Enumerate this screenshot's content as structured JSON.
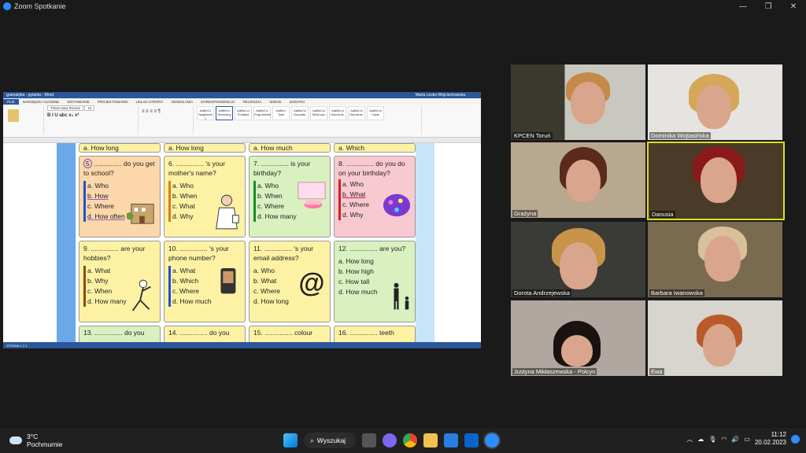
{
  "window": {
    "title": "Zoom Spotkanie"
  },
  "word": {
    "title_bar": "gramatyka - pytania - Word",
    "user": "Maria Lesko-Wojciechowska",
    "tabs": [
      "PLIK",
      "NARZĘDZIA GŁÓWNE",
      "WSTAWIANIE",
      "PROJEKTOWANIE",
      "UKŁAD STRONY",
      "ODWOŁANIA",
      "KORESPONDENCJA",
      "RECENZJA",
      "WIDOK",
      "DODATKI"
    ],
    "font": "Times New Roman",
    "font_size": "12",
    "styles": [
      "AaBbCc",
      "AaBbCc",
      "AaBbCcI",
      "AaBbCcI",
      "AaBbC",
      "AaBbCcI",
      "AaBbCcI",
      "AaBbCcI",
      "AaBbCcI",
      "AaBbCcI"
    ],
    "style_names": [
      "Nagłówek 1",
      "Normalny",
      "Podtytuł",
      "Pogrubienie",
      "Tytuł",
      "Uwydatn.",
      "Tekst wyr.",
      "Wyróżnie.",
      "Wyróżnie.",
      "Cytat"
    ],
    "status": "STRONA 1 Z 1"
  },
  "worksheet": {
    "top": [
      "a. How long",
      "a. How long",
      "a. How much",
      "a. Which"
    ],
    "cells": [
      {
        "num": "5",
        "q": "............... do you get to school?",
        "opts": [
          "a. Who",
          "b. How",
          "c. Where",
          "d. How often"
        ]
      },
      {
        "num": "6.",
        "q": "............... 's your mother's name?",
        "opts": [
          "a. Who",
          "b. When",
          "c. What",
          "d. Why"
        ]
      },
      {
        "num": "7.",
        "q": "............... is your birthday?",
        "opts": [
          "a. Who",
          "b. When",
          "c. Where",
          "d. How many"
        ]
      },
      {
        "num": "8.",
        "q": "............... do you do on your birthday?",
        "opts": [
          "a. Who",
          "b. What",
          "c. Where",
          "d. Why"
        ]
      },
      {
        "num": "9.",
        "q": "............... are your hobbies?",
        "opts": [
          "a. What",
          "b. Why",
          "c. When",
          "d. How many"
        ]
      },
      {
        "num": "10.",
        "q": "............... 's your phone number?",
        "opts": [
          "a. What",
          "b. Which",
          "c. Where",
          "d. How much"
        ]
      },
      {
        "num": "11.",
        "q": "............... 's your email address?",
        "opts": [
          "a. Who",
          "b. What",
          "c. Where",
          "d. How long"
        ]
      },
      {
        "num": "12.",
        "q": "............... are you?",
        "opts": [
          "a. How long",
          "b. How high",
          "c. How tall",
          "d. How much"
        ]
      }
    ],
    "bottom": [
      {
        "num": "13.",
        "q": "............... do you"
      },
      {
        "num": "14.",
        "q": "............... do you"
      },
      {
        "num": "15.",
        "q": "............... colour"
      },
      {
        "num": "16.",
        "q": "............... teeth"
      }
    ]
  },
  "participants": [
    {
      "name": "KPCEN Toruń"
    },
    {
      "name": "Dominika Wojtasińska"
    },
    {
      "name": "Grażyna"
    },
    {
      "name": "Danusia"
    },
    {
      "name": "Dorota Andrzejewska"
    },
    {
      "name": "Barbara Iwanowska"
    },
    {
      "name": "Justyna Mikłaszewska - Polcyn"
    },
    {
      "name": "Ewa"
    }
  ],
  "taskbar": {
    "weather_temp": "3°C",
    "weather_desc": "Pochmurnie",
    "search": "Wyszukaj",
    "time": "11:12",
    "date": "20.02.2023"
  }
}
